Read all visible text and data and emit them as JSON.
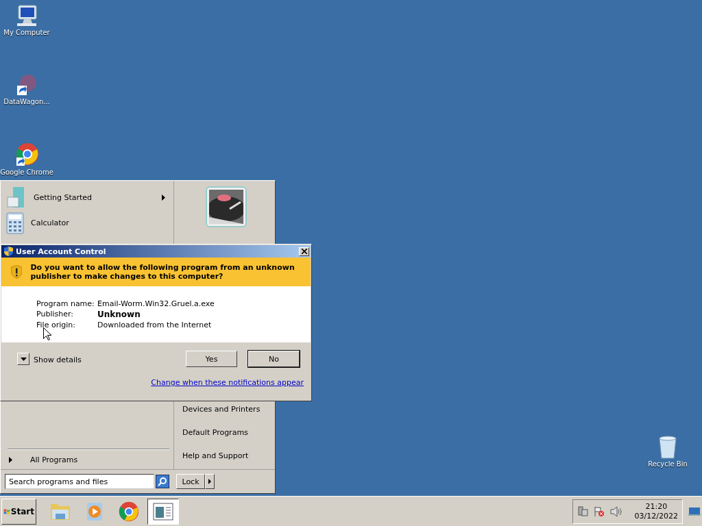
{
  "desktop_icons": [
    {
      "label": "My Computer",
      "kind": "computer"
    },
    {
      "label": "DataWagon...",
      "kind": "faded"
    },
    {
      "label": "Google Chrome",
      "kind": "chrome"
    }
  ],
  "recycle_bin": {
    "label": "Recycle Bin"
  },
  "start_menu": {
    "pinned": [
      {
        "label": "Getting Started",
        "kind": "getting-started",
        "submenu": true
      },
      {
        "label": "Calculator",
        "kind": "calculator",
        "submenu": false
      }
    ],
    "all_programs": "All Programs",
    "links": [
      "Devices and Printers",
      "Default Programs",
      "Help and Support"
    ],
    "search": {
      "placeholder": "Search programs and files"
    },
    "power_button": "Lock"
  },
  "dialog": {
    "title": "User Account Control",
    "question": "Do you want to allow the following program from an unknown publisher to make changes to this computer?",
    "fields": [
      {
        "label": "Program name:",
        "value": "Email-Worm.Win32.Gruel.a.exe",
        "emphasized": false
      },
      {
        "label": "Publisher:",
        "value": "Unknown",
        "emphasized": true
      },
      {
        "label": "File origin:",
        "value": "Downloaded from the Internet",
        "emphasized": false
      }
    ],
    "details_toggle": {
      "label": "Show details",
      "expanded": false
    },
    "buttons": [
      {
        "label": "Yes",
        "default": false
      },
      {
        "label": "No",
        "default": true
      }
    ],
    "link": "Change when these notifications appear"
  },
  "taskbar": {
    "start": "Start",
    "apps": [
      {
        "kind": "folder",
        "active": false
      },
      {
        "kind": "media",
        "active": false
      },
      {
        "kind": "chrome",
        "active": false
      },
      {
        "kind": "window",
        "active": true
      }
    ],
    "time": "21:20",
    "date": "03/12/2022"
  }
}
